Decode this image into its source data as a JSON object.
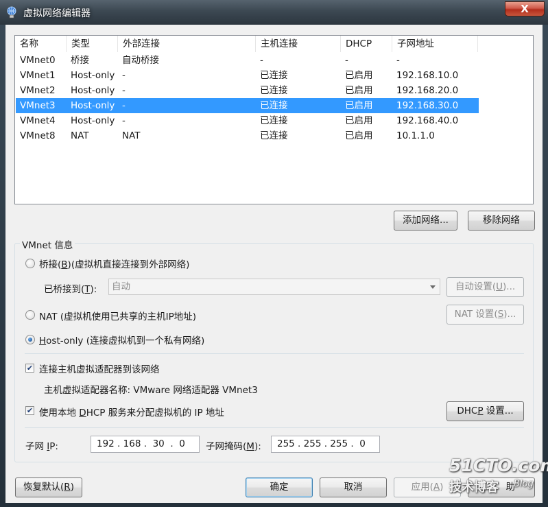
{
  "window": {
    "title": "虚拟网络编辑器",
    "close_glyph": "X"
  },
  "network_list": {
    "columns": [
      "名称",
      "类型",
      "外部连接",
      "主机连接",
      "DHCP",
      "子网地址"
    ],
    "rows": [
      {
        "name": "VMnet0",
        "type": "桥接",
        "external": "自动桥接",
        "host": "-",
        "dhcp": "-",
        "subnet": "-",
        "selected": false
      },
      {
        "name": "VMnet1",
        "type": "Host-only",
        "external": "-",
        "host": "已连接",
        "dhcp": "已启用",
        "subnet": "192.168.10.0",
        "selected": false
      },
      {
        "name": "VMnet2",
        "type": "Host-only",
        "external": "-",
        "host": "已连接",
        "dhcp": "已启用",
        "subnet": "192.168.20.0",
        "selected": false
      },
      {
        "name": "VMnet3",
        "type": "Host-only",
        "external": "-",
        "host": "已连接",
        "dhcp": "已启用",
        "subnet": "192.168.30.0",
        "selected": true
      },
      {
        "name": "VMnet4",
        "type": "Host-only",
        "external": "-",
        "host": "已连接",
        "dhcp": "已启用",
        "subnet": "192.168.40.0",
        "selected": false
      },
      {
        "name": "VMnet8",
        "type": "NAT",
        "external": "NAT",
        "host": "已连接",
        "dhcp": "已启用",
        "subnet": "10.1.1.0",
        "selected": false
      }
    ]
  },
  "list_buttons": {
    "add": "添加网络...",
    "remove": "移除网络"
  },
  "vmnet_info": {
    "title": "VMnet 信息",
    "bridged": {
      "label_pre": "桥接(",
      "label_key": "B",
      "label_post": ")(虚拟机直接连接到外部网络)",
      "checked": false
    },
    "bridged_to": {
      "label_pre": "已桥接到(",
      "label_key": "T",
      "label_post": "):",
      "value": "自动",
      "auto_btn_pre": "自动设置(",
      "auto_btn_key": "U",
      "auto_btn_post": ")..."
    },
    "nat": {
      "label": "NAT (虚拟机使用已共享的主机IP地址)",
      "checked": false,
      "btn_pre": "NAT 设置(",
      "btn_key": "S",
      "btn_post": ")..."
    },
    "hostonly": {
      "label_key": "H",
      "label_rest": "ost-only (连接虚拟机到一个私有网络)",
      "checked": true
    },
    "connect_adapter": {
      "label": "连接主机虚拟适配器到该网络",
      "checked": true
    },
    "adapter_name_text": "主机虚拟适配器名称: VMware 网络适配器 VMnet3",
    "use_dhcp": {
      "label_pre": "使用本地 ",
      "label_key": "D",
      "label_post": "HCP 服务来分配虚拟机的 IP 地址",
      "checked": true
    },
    "dhcp_btn_pre": "DHC",
    "dhcp_btn_key": "P",
    "dhcp_btn_post": " 设置...",
    "subnet_ip": {
      "label_pre": "子网 ",
      "label_key": "I",
      "label_post": "P:",
      "value": "192 . 168 .  30  .  0"
    },
    "subnet_mask": {
      "label_pre": "子网掩码(",
      "label_key": "M",
      "label_post": "):",
      "value": "255 . 255 . 255 .  0"
    }
  },
  "footer": {
    "restore_pre": "恢复默认(",
    "restore_key": "R",
    "restore_post": ")",
    "ok": "确定",
    "cancel": "取消",
    "apply_pre": "应用(",
    "apply_key": "A",
    "apply_post": ")",
    "help_tail": "助"
  },
  "watermark": {
    "site": "51CTO.com",
    "tagline": "技术博客",
    "blog": "Blog"
  }
}
